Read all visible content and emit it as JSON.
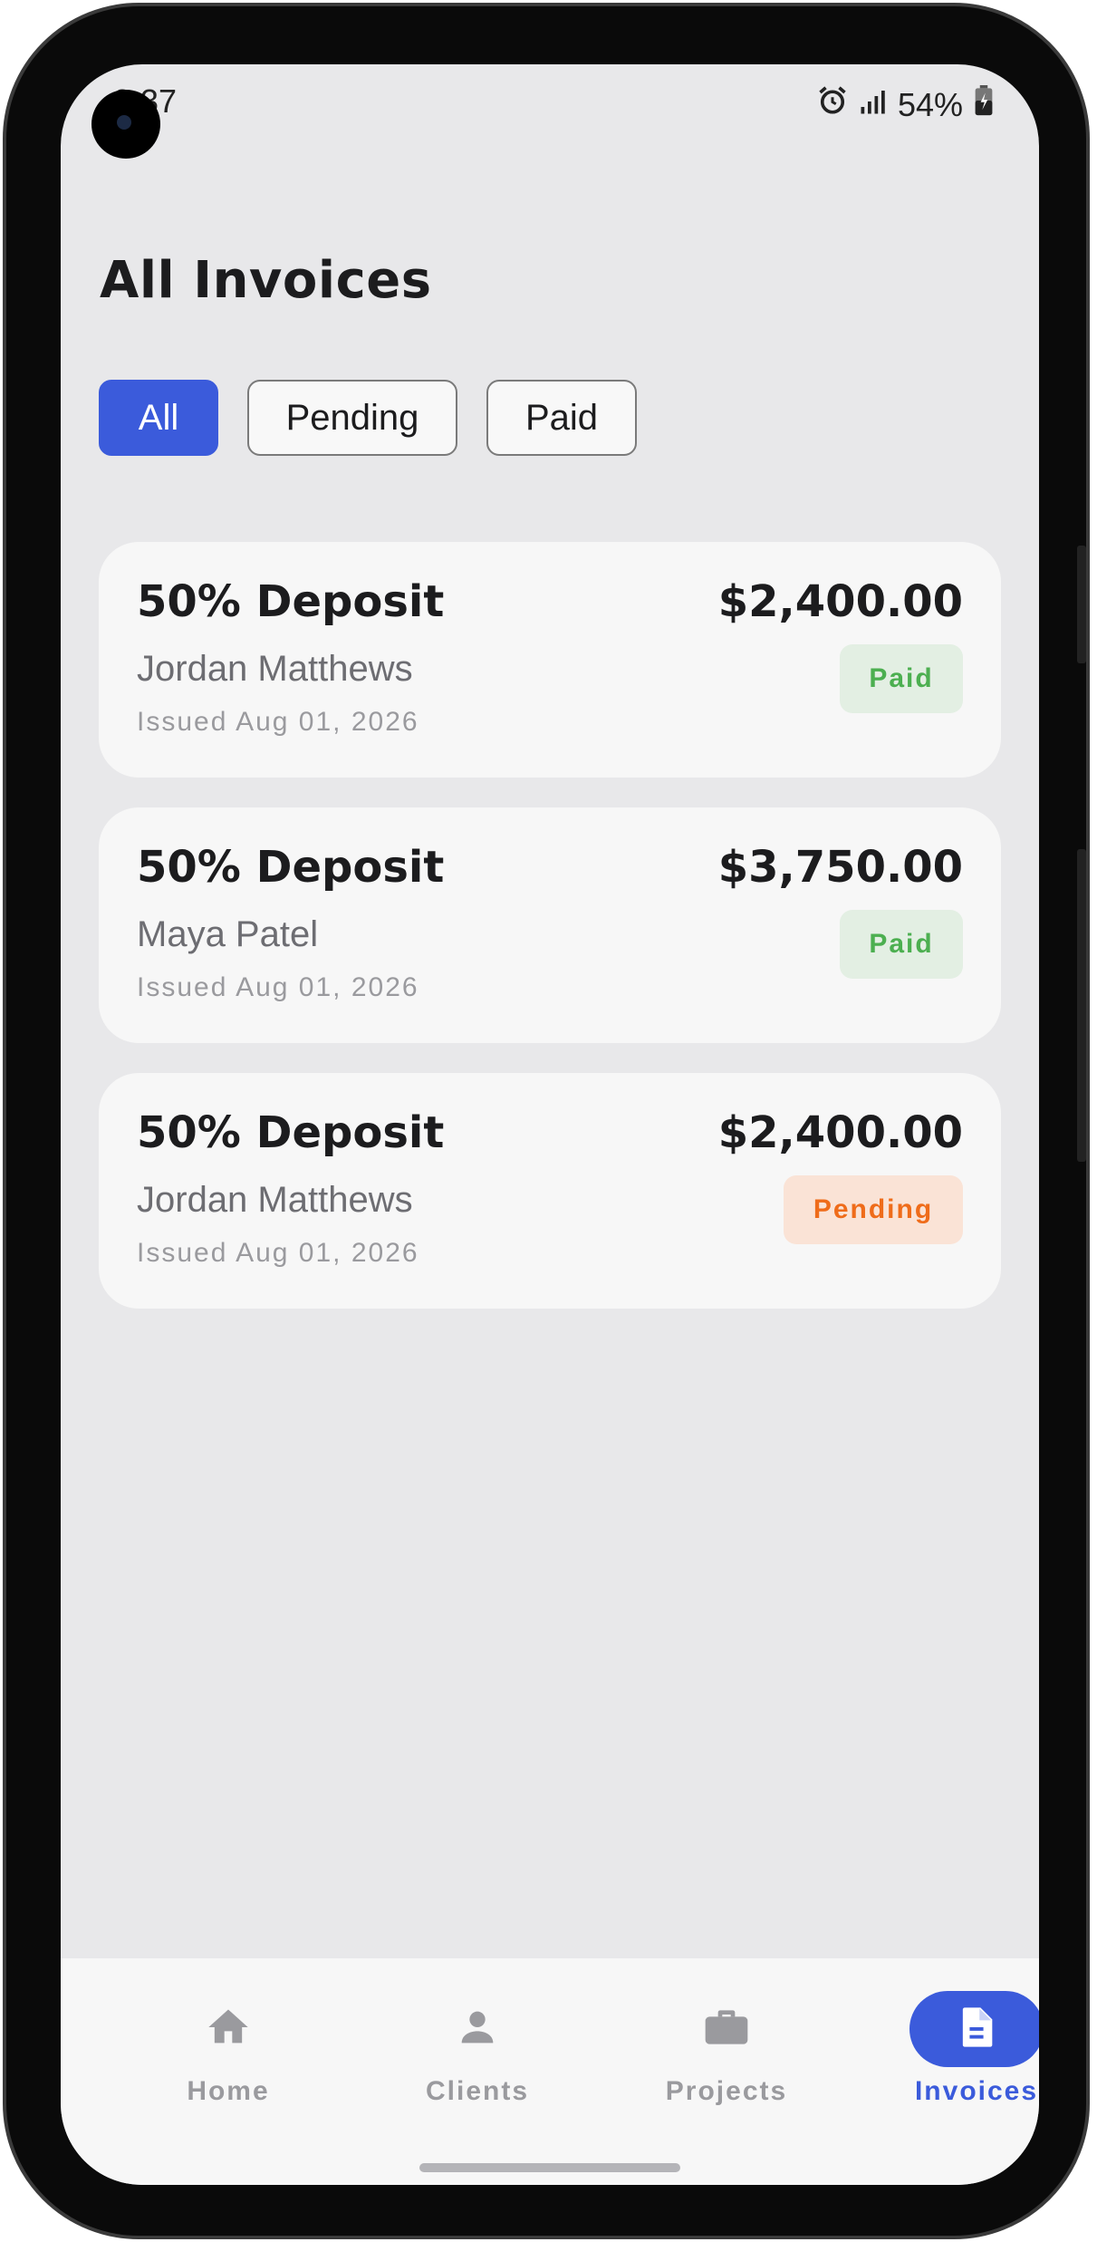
{
  "status_bar": {
    "time": "3:37",
    "battery": "54%"
  },
  "page": {
    "title": "All Invoices"
  },
  "filters": [
    {
      "label": "All",
      "active": true
    },
    {
      "label": "Pending",
      "active": false
    },
    {
      "label": "Paid",
      "active": false
    }
  ],
  "invoices": [
    {
      "title": "50% Deposit",
      "client": "Jordan Matthews",
      "issued": "Issued Aug 01, 2026",
      "amount": "$2,400.00",
      "status": "Paid"
    },
    {
      "title": "50% Deposit",
      "client": "Maya Patel",
      "issued": "Issued Aug 01, 2026",
      "amount": "$3,750.00",
      "status": "Paid"
    },
    {
      "title": "50% Deposit",
      "client": "Jordan Matthews",
      "issued": "Issued Aug 01, 2026",
      "amount": "$2,400.00",
      "status": "Pending"
    }
  ],
  "nav": [
    {
      "label": "Home",
      "icon": "home-icon",
      "active": false
    },
    {
      "label": "Clients",
      "icon": "person-icon",
      "active": false
    },
    {
      "label": "Projects",
      "icon": "briefcase-icon",
      "active": false
    },
    {
      "label": "Invoices",
      "icon": "document-icon",
      "active": true
    }
  ],
  "colors": {
    "accent": "#3b5bdb",
    "background": "#e8e8ea",
    "card": "#f7f7f7",
    "paid_text": "#4caf50",
    "paid_bg": "#e3efe3",
    "pending_text": "#ef6c1a",
    "pending_bg": "#fae3d6"
  }
}
